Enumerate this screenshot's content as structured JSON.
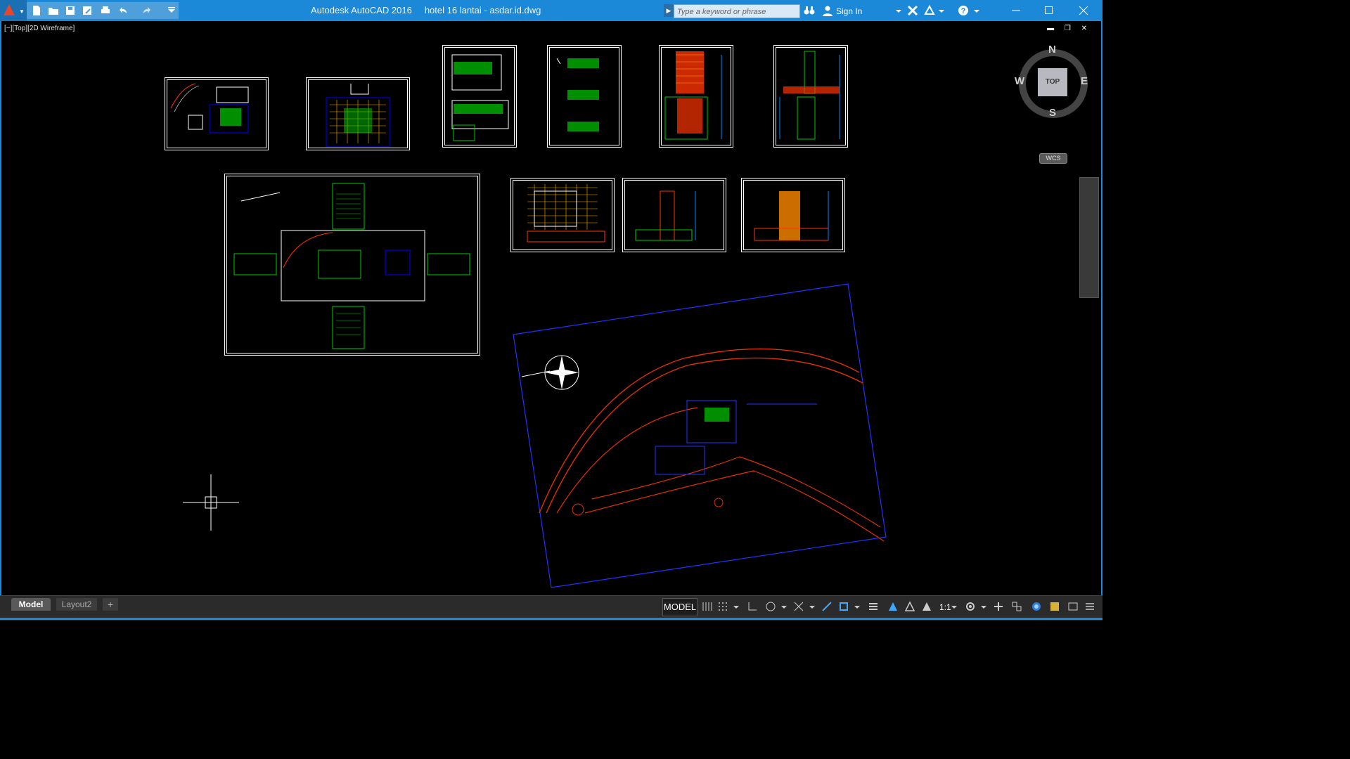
{
  "titlebar": {
    "app_name": "Autodesk AutoCAD 2016",
    "file_name": "hotel 16 lantai - asdar.id.dwg",
    "search_placeholder": "Type a keyword or phrase",
    "sign_in": "Sign In"
  },
  "viewport": {
    "label": "[−][Top][2D Wireframe]",
    "controls": "▬ ❐ ✕"
  },
  "viewcube": {
    "north": "N",
    "south": "S",
    "east": "E",
    "west": "W",
    "face": "TOP",
    "ucs": "WCS"
  },
  "tabs": {
    "model": "Model",
    "layout2": "Layout2",
    "add": "+"
  },
  "status": {
    "model_label": "MODEL",
    "scale": "1:1"
  },
  "colors": {
    "title_bar": "#1b88d8",
    "canvas": "#000000",
    "green": "#00ff00",
    "blue": "#0000ff",
    "red": "#ff3300",
    "orange": "#ff8800",
    "white": "#ffffff"
  }
}
